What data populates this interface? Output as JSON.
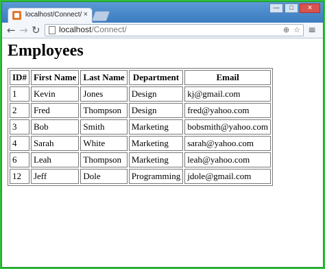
{
  "browser": {
    "tab_title": "localhost/Connect/",
    "tab_close": "×",
    "window_controls": [
      "—",
      "□",
      "✕"
    ],
    "address": {
      "host": "localhost",
      "path": "/Connect/"
    },
    "icons": {
      "back": "arrow-left-icon",
      "forward": "arrow-right-icon",
      "reload": "reload-icon",
      "page": "page-icon",
      "zoom": "zoom-icon",
      "star": "star-icon",
      "menu": "menu-icon"
    }
  },
  "page": {
    "title": "Employees",
    "table": {
      "headers": [
        "ID#",
        "First Name",
        "Last Name",
        "Department",
        "Email"
      ],
      "rows": [
        [
          "1",
          "Kevin",
          "Jones",
          "Design",
          "kj@gmail.com"
        ],
        [
          "2",
          "Fred",
          "Thompson",
          "Design",
          "fred@yahoo.com"
        ],
        [
          "3",
          "Bob",
          "Smith",
          "Marketing",
          "bobsmith@yahoo.com"
        ],
        [
          "4",
          "Sarah",
          "White",
          "Marketing",
          "sarah@yahoo.com"
        ],
        [
          "6",
          "Leah",
          "Thompson",
          "Marketing",
          "leah@yahoo.com"
        ],
        [
          "12",
          "Jeff",
          "Dole",
          "Programming",
          "jdole@gmail.com"
        ]
      ]
    }
  }
}
